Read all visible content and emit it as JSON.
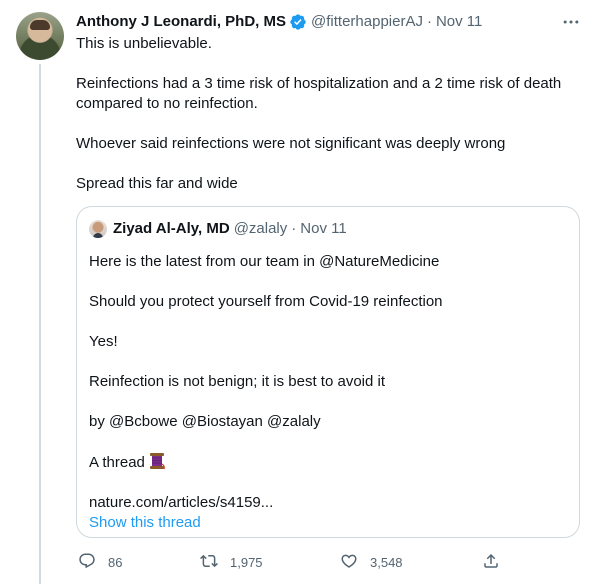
{
  "tweet": {
    "author_name": "Anthony J Leonardi, PhD, MS",
    "author_handle": "@fitterhappierAJ",
    "separator": "·",
    "date": "Nov 11",
    "paragraphs": [
      "This is unbelievable.",
      "Reinfections had a 3 time risk of hospitalization and a 2 time risk of death compared to no reinfection.",
      "Whoever said reinfections were not significant was deeply wrong",
      "Spread this far and wide"
    ]
  },
  "quote": {
    "author_name": "Ziyad Al-Aly, MD",
    "author_handle": "@zalaly",
    "separator": "·",
    "date": "Nov 11",
    "paragraphs": [
      "Here is the latest from our team in @NatureMedicine",
      "Should you protect yourself from Covid-19 reinfection",
      "Yes!",
      "Reinfection is not benign; it is best to avoid it",
      "by @Bcbowe @Biostayan @zalaly",
      "A thread"
    ],
    "link": "nature.com/articles/s4159...",
    "show_thread": "Show this thread"
  },
  "actions": {
    "replies": "86",
    "retweets": "1,975",
    "likes": "3,548"
  },
  "colors": {
    "accent": "#1d9bf0",
    "muted": "#536471",
    "border": "#cfd9de"
  },
  "icons": {
    "verified": "verified-badge-icon",
    "more": "more-options-icon",
    "reply": "reply-icon",
    "retweet": "retweet-icon",
    "like": "heart-icon",
    "share": "share-icon",
    "spool": "thread-spool-icon"
  }
}
